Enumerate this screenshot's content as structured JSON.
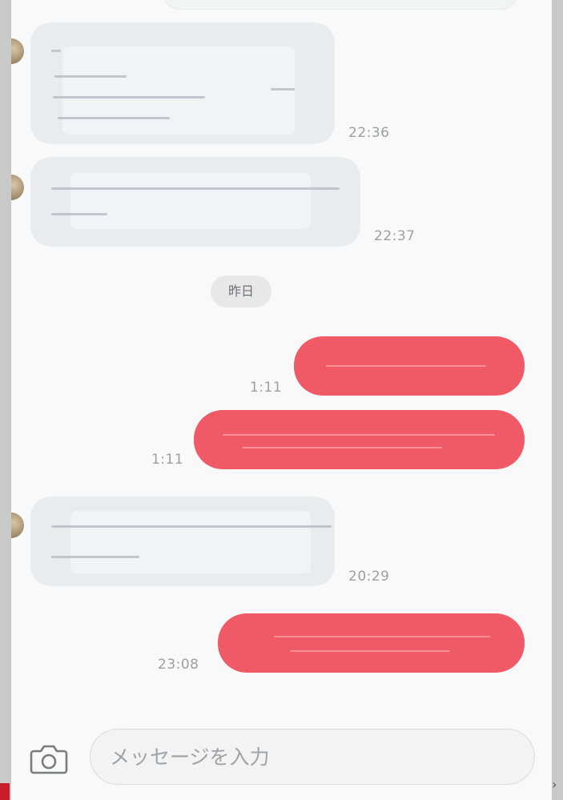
{
  "chat": {
    "messages": [
      {
        "direction": "incoming",
        "time": "22:36"
      },
      {
        "direction": "incoming",
        "time": "22:37"
      },
      {
        "direction": "outgoing",
        "time": "1:11"
      },
      {
        "direction": "outgoing",
        "time": "1:11"
      },
      {
        "direction": "incoming",
        "time": "20:29"
      },
      {
        "direction": "outgoing",
        "time": "23:08"
      }
    ],
    "date_separator": "昨日"
  },
  "composer": {
    "placeholder": "メッセージを入力",
    "value": "",
    "camera_icon": "camera-icon"
  },
  "colors": {
    "outgoing_bubble": "#f05a66",
    "incoming_bubble": "#e9ecee",
    "timestamp": "#9aa0a4",
    "background": "#f9f9f9"
  }
}
